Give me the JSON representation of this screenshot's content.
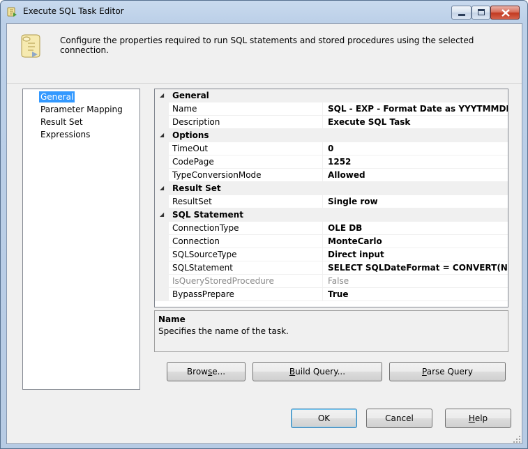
{
  "window": {
    "title": "Execute SQL Task Editor",
    "controls": [
      "minimize",
      "maximize",
      "close"
    ]
  },
  "header": {
    "description": "Configure the properties required to run SQL statements and stored procedures using the selected connection."
  },
  "nav": {
    "items": [
      {
        "label": "General",
        "selected": true
      },
      {
        "label": "Parameter Mapping",
        "selected": false
      },
      {
        "label": "Result Set",
        "selected": false
      },
      {
        "label": "Expressions",
        "selected": false
      }
    ]
  },
  "grid": {
    "categories": {
      "general": "General",
      "options": "Options",
      "result_set": "Result Set",
      "sql_statement": "SQL Statement"
    },
    "toggle_glyph": "◢",
    "props": {
      "name": {
        "name": "Name",
        "value": "SQL - EXP - Format Date as YYYTMMDD"
      },
      "description": {
        "name": "Description",
        "value": "Execute SQL Task"
      },
      "timeout": {
        "name": "TimeOut",
        "value": "0"
      },
      "codepage": {
        "name": "CodePage",
        "value": "1252"
      },
      "typeconversion": {
        "name": "TypeConversionMode",
        "value": "Allowed"
      },
      "resultset": {
        "name": "ResultSet",
        "value": "Single row"
      },
      "connectiontype": {
        "name": "ConnectionType",
        "value": "OLE DB"
      },
      "connection": {
        "name": "Connection",
        "value": "MonteCarlo"
      },
      "sqlsourcetype": {
        "name": "SQLSourceType",
        "value": "Direct input"
      },
      "sqlstatement": {
        "name": "SQLStatement",
        "value": "SELECT SQLDateFormat = CONVERT(NVARCHA"
      },
      "isquerystoredprocedure": {
        "name": "IsQueryStoredProcedure",
        "value": "False"
      },
      "bypassprepare": {
        "name": "BypassPrepare",
        "value": "True"
      }
    }
  },
  "description_panel": {
    "title": "Name",
    "text": "Specifies the name of the task."
  },
  "buttons": {
    "browse": {
      "pre": "Brow",
      "accel": "s",
      "post": "e..."
    },
    "build_query": {
      "pre": "",
      "accel": "B",
      "post": "uild Query..."
    },
    "parse_query": {
      "pre": "",
      "accel": "P",
      "post": "arse Query"
    },
    "ok": {
      "pre": "OK",
      "accel": "",
      "post": ""
    },
    "cancel": {
      "pre": "Cancel",
      "accel": "",
      "post": ""
    },
    "help": {
      "pre": "",
      "accel": "H",
      "post": "elp"
    }
  },
  "colors": {
    "selection": "#3399ff",
    "category_band": "#f0f0f0",
    "window_frame": "#bfcfe2"
  }
}
